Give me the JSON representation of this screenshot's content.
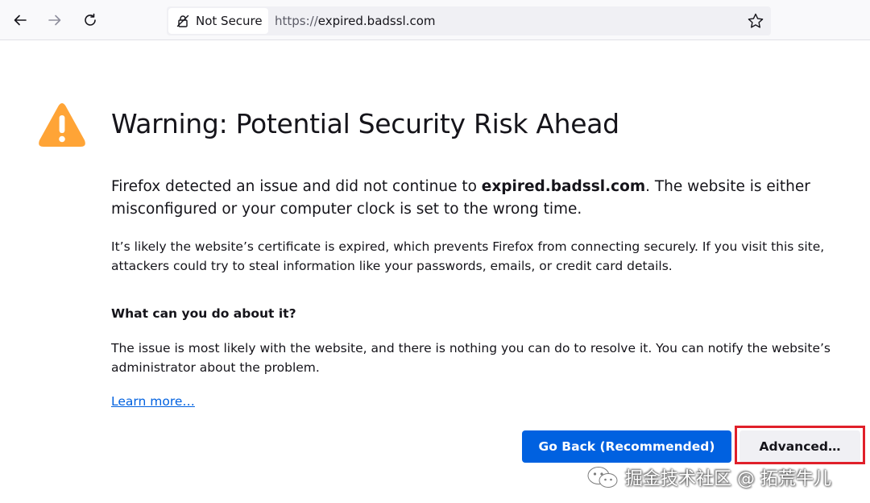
{
  "toolbar": {
    "back_icon": "arrow-left-icon",
    "forward_icon": "arrow-right-icon",
    "reload_icon": "reload-icon",
    "identity_label": "Not Secure",
    "url_prefix": "https://",
    "url_domain": "expired.badssl.com",
    "bookmark_icon": "star-icon"
  },
  "page": {
    "title": "Warning: Potential Security Risk Ahead",
    "intro_before": "Firefox detected an issue and did not continue to ",
    "intro_host": "expired.badssl.com",
    "intro_after": ". The website is either misconfigured or your computer clock is set to the wrong time.",
    "detail": "It’s likely the website’s certificate is expired, which prevents Firefox from connecting securely. If you visit this site, attackers could try to steal information like your passwords, emails, or credit card details.",
    "subhead": "What can you do about it?",
    "advice": "The issue is most likely with the website, and there is nothing you can do to resolve it. You can notify the website’s administrator about the problem.",
    "learn_more": "Learn more…",
    "go_back_label": "Go Back (Recommended)",
    "advanced_label": "Advanced…"
  },
  "watermark": {
    "text": "掘金技术社区 @ 拓荒牛儿"
  },
  "colors": {
    "warning": "#ffa436",
    "primary_button": "#0061e0",
    "highlight": "#e0202a",
    "link": "#0061e0"
  }
}
